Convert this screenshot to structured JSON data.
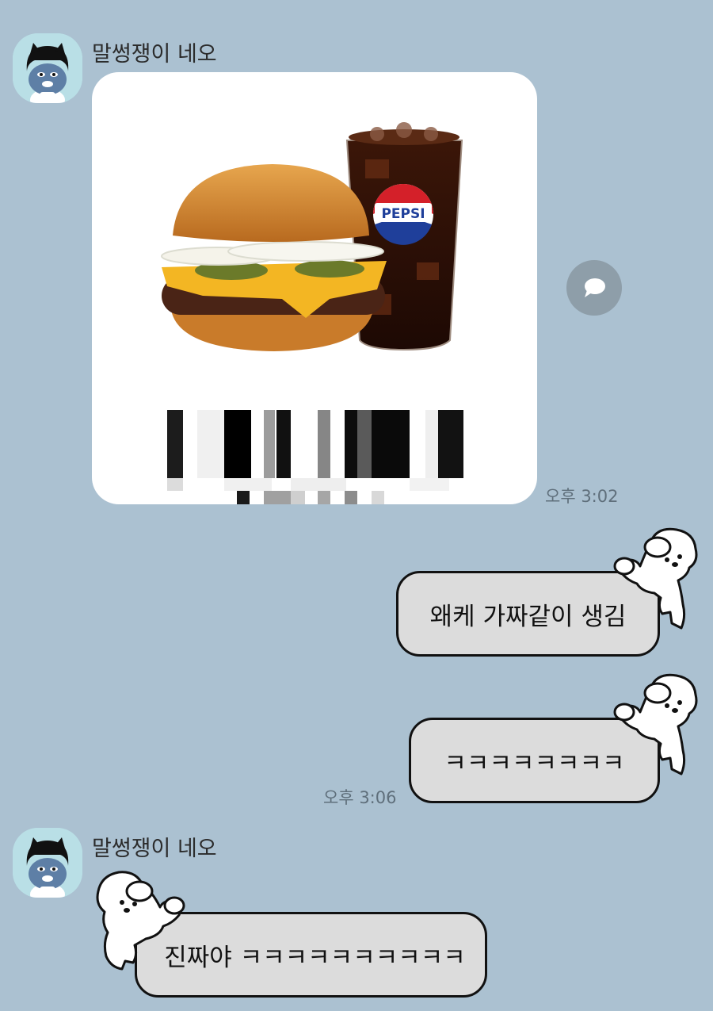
{
  "messages": [
    {
      "sender": "말썽쟁이 네오",
      "type": "image",
      "product_brand": "PEPSI",
      "time": "오후 3:02"
    },
    {
      "from": "me",
      "type": "text",
      "text": "왜케 가짜같이 생김"
    },
    {
      "from": "me",
      "type": "text",
      "text": "ㅋㅋㅋㅋㅋㅋㅋㅋ",
      "time": "오후 3:06"
    },
    {
      "sender": "말썽쟁이 네오",
      "type": "text",
      "text": "진짜야 ㅋㅋㅋㅋㅋㅋㅋㅋㅋㅋ"
    }
  ],
  "colors": {
    "chat_background": "#abc1d1",
    "bubble_fill": "#dcdcdc",
    "bubble_border": "#111111",
    "share_button": "#8e9ea9",
    "avatar_background": "#b9dfe6"
  },
  "icons": {
    "avatar": "neo-cat-character-avatar",
    "share": "speech-bubble-share-icon",
    "sticker_frame": "white-puppy-sticker"
  }
}
